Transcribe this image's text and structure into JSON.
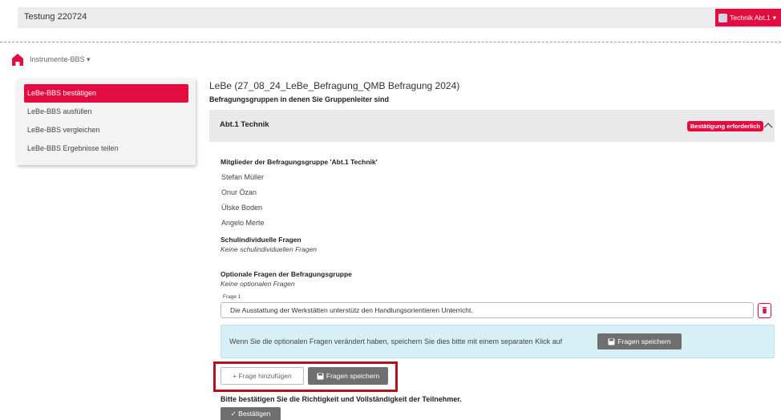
{
  "topbar": {
    "title": "Testung 220724",
    "user_label": "Technik Abt.1"
  },
  "nav": {
    "instrument_label": "Instrumente-BBS"
  },
  "sidebar": {
    "items": [
      {
        "label": "LeBe-BBS bestätigen",
        "active": true
      },
      {
        "label": "LeBe-BBS ausfüllen"
      },
      {
        "label": "LeBe-BBS vergleichen"
      },
      {
        "label": "LeBe-BBS Ergebnisse teilen"
      }
    ]
  },
  "main": {
    "title": "LeBe (27_08_24_LeBe_Befragung_QMB Befragung 2024)",
    "subtitle": "Befragungsgruppen in denen Sie Gruppenleiter sind",
    "group": {
      "name": "Abt.1 Technik",
      "badge": "Bestätigung erforderlich",
      "members_title": "Mitglieder der Befragungsgruppe 'Abt.1 Technik'",
      "members": [
        "Stefan Müller",
        "Onur Özan",
        "Ülske Boden",
        "Angelo Merte"
      ],
      "school_questions_title": "Schulindividuelle Fragen",
      "school_questions_empty": "Keine schulindividuellen Fragen",
      "optional_questions_title": "Optionale Fragen der Befragungsgruppe",
      "optional_questions_empty": "Keine optionalen Fragen",
      "question_label": "Frage 1",
      "question_value": "Die Ausstattung der Werkstätten unterstütz den Handlungsorientieren Unterricht.",
      "info_text": "Wenn Sie die optionalen Fragen verändert haben, speichern Sie dies bitte mit einem separaten Klick auf",
      "save_button": "Fragen speichern",
      "add_button": "+ Frage hinzufügen",
      "confirm_text": "Bitte bestätigen Sie die Richtigkeit und Vollständigkeit der Teilnehmer.",
      "confirm_button": "✓ Bestätigen"
    }
  },
  "colors": {
    "accent": "#e30b40",
    "info_bg": "#d6f0f6",
    "highlight": "#b1121e",
    "button_dark": "#6f6f6f"
  }
}
